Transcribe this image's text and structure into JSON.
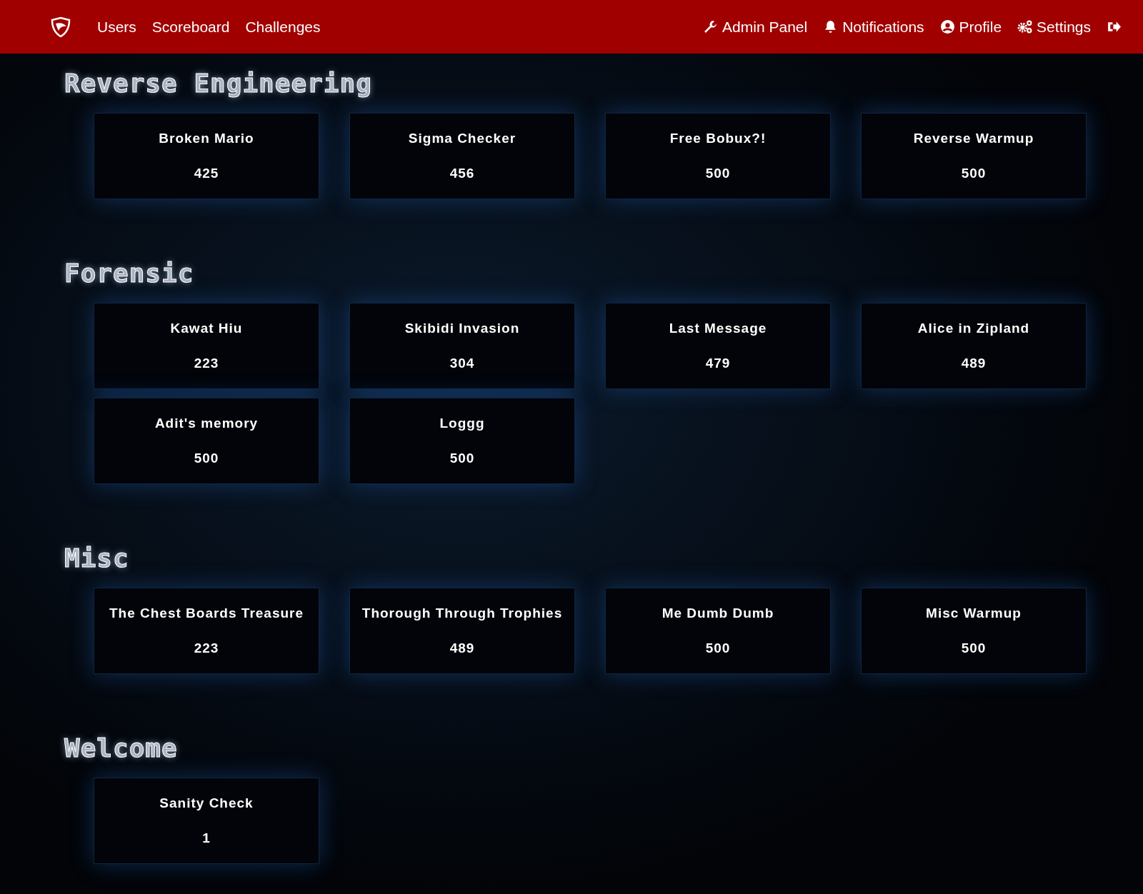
{
  "nav": {
    "left": [
      {
        "label": "Users"
      },
      {
        "label": "Scoreboard"
      },
      {
        "label": "Challenges"
      }
    ],
    "right": [
      {
        "kind": "admin",
        "label": "Admin Panel"
      },
      {
        "kind": "notifications",
        "label": "Notifications"
      },
      {
        "kind": "profile",
        "label": "Profile"
      },
      {
        "kind": "settings",
        "label": "Settings"
      },
      {
        "kind": "logout"
      }
    ]
  },
  "categories": [
    {
      "title": "Reverse Engineering",
      "challenges": [
        {
          "name": "Broken Mario",
          "points": "425"
        },
        {
          "name": "Sigma Checker",
          "points": "456"
        },
        {
          "name": "Free Bobux?!",
          "points": "500"
        },
        {
          "name": "Reverse Warmup",
          "points": "500"
        }
      ]
    },
    {
      "title": "Forensic",
      "challenges": [
        {
          "name": "Kawat Hiu",
          "points": "223"
        },
        {
          "name": "Skibidi Invasion",
          "points": "304"
        },
        {
          "name": "Last Message",
          "points": "479"
        },
        {
          "name": "Alice in Zipland",
          "points": "489"
        },
        {
          "name": "Adit's memory",
          "points": "500"
        },
        {
          "name": "Loggg",
          "points": "500"
        }
      ]
    },
    {
      "title": "Misc",
      "challenges": [
        {
          "name": "The Chest Boards Treasure",
          "points": "223"
        },
        {
          "name": "Thorough Through Trophies",
          "points": "489"
        },
        {
          "name": "Me Dumb Dumb",
          "points": "500"
        },
        {
          "name": "Misc Warmup",
          "points": "500"
        }
      ]
    },
    {
      "title": "Welcome",
      "challenges": [
        {
          "name": "Sanity Check",
          "points": "1"
        }
      ]
    }
  ]
}
